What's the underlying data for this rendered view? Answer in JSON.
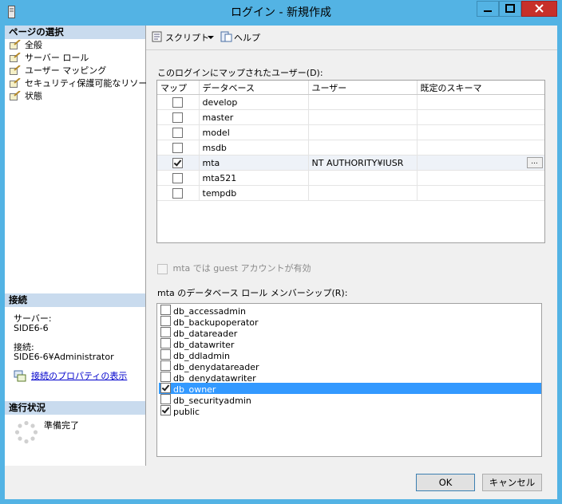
{
  "window": {
    "title": "ログイン - 新規作成"
  },
  "left": {
    "page_select_header": "ページの選択",
    "pages": [
      {
        "label": "全般"
      },
      {
        "label": "サーバー ロール"
      },
      {
        "label": "ユーザー マッピング"
      },
      {
        "label": "セキュリティ保護可能なリソース"
      },
      {
        "label": "状態"
      }
    ],
    "connection_header": "接続",
    "server_label": "サーバー:",
    "server_value": "SIDE6-6",
    "connection_label": "接続:",
    "connection_value": "SIDE6-6¥Administrator",
    "view_properties_link": "接続のプロパティの表示",
    "progress_header": "進行状況",
    "progress_status": "準備完了"
  },
  "toolbar": {
    "script_label": "スクリプト",
    "help_label": "ヘルプ"
  },
  "user_mapping": {
    "label": "このログインにマップされたユーザー(D):",
    "columns": [
      "マップ",
      "データベース",
      "ユーザー",
      "既定のスキーマ"
    ],
    "rows": [
      {
        "map": false,
        "database": "develop",
        "user": "",
        "schema": ""
      },
      {
        "map": false,
        "database": "master",
        "user": "",
        "schema": ""
      },
      {
        "map": false,
        "database": "model",
        "user": "",
        "schema": ""
      },
      {
        "map": false,
        "database": "msdb",
        "user": "",
        "schema": ""
      },
      {
        "map": true,
        "database": "mta",
        "user": "NT AUTHORITY¥IUSR",
        "schema": ""
      },
      {
        "map": false,
        "database": "mta521",
        "user": "",
        "schema": ""
      },
      {
        "map": false,
        "database": "tempdb",
        "user": "",
        "schema": ""
      }
    ],
    "ellipsis_label": "..."
  },
  "guest": {
    "label": "mta では guest アカウントが有効",
    "checked": false
  },
  "roles": {
    "label": "mta のデータベース ロール メンバーシップ(R):",
    "items": [
      {
        "name": "db_accessadmin",
        "checked": false
      },
      {
        "name": "db_backupoperator",
        "checked": false
      },
      {
        "name": "db_datareader",
        "checked": false
      },
      {
        "name": "db_datawriter",
        "checked": false
      },
      {
        "name": "db_ddladmin",
        "checked": false
      },
      {
        "name": "db_denydatareader",
        "checked": false
      },
      {
        "name": "db_denydatawriter",
        "checked": false
      },
      {
        "name": "db_owner",
        "checked": true
      },
      {
        "name": "db_securityadmin",
        "checked": false
      },
      {
        "name": "public",
        "checked": true
      }
    ]
  },
  "buttons": {
    "ok": "OK",
    "cancel": "キャンセル"
  },
  "colors": {
    "titlebar": "#53b3e4",
    "section_header": "#c9dbee",
    "selection": "#3399ff",
    "close_button": "#c7302a"
  }
}
